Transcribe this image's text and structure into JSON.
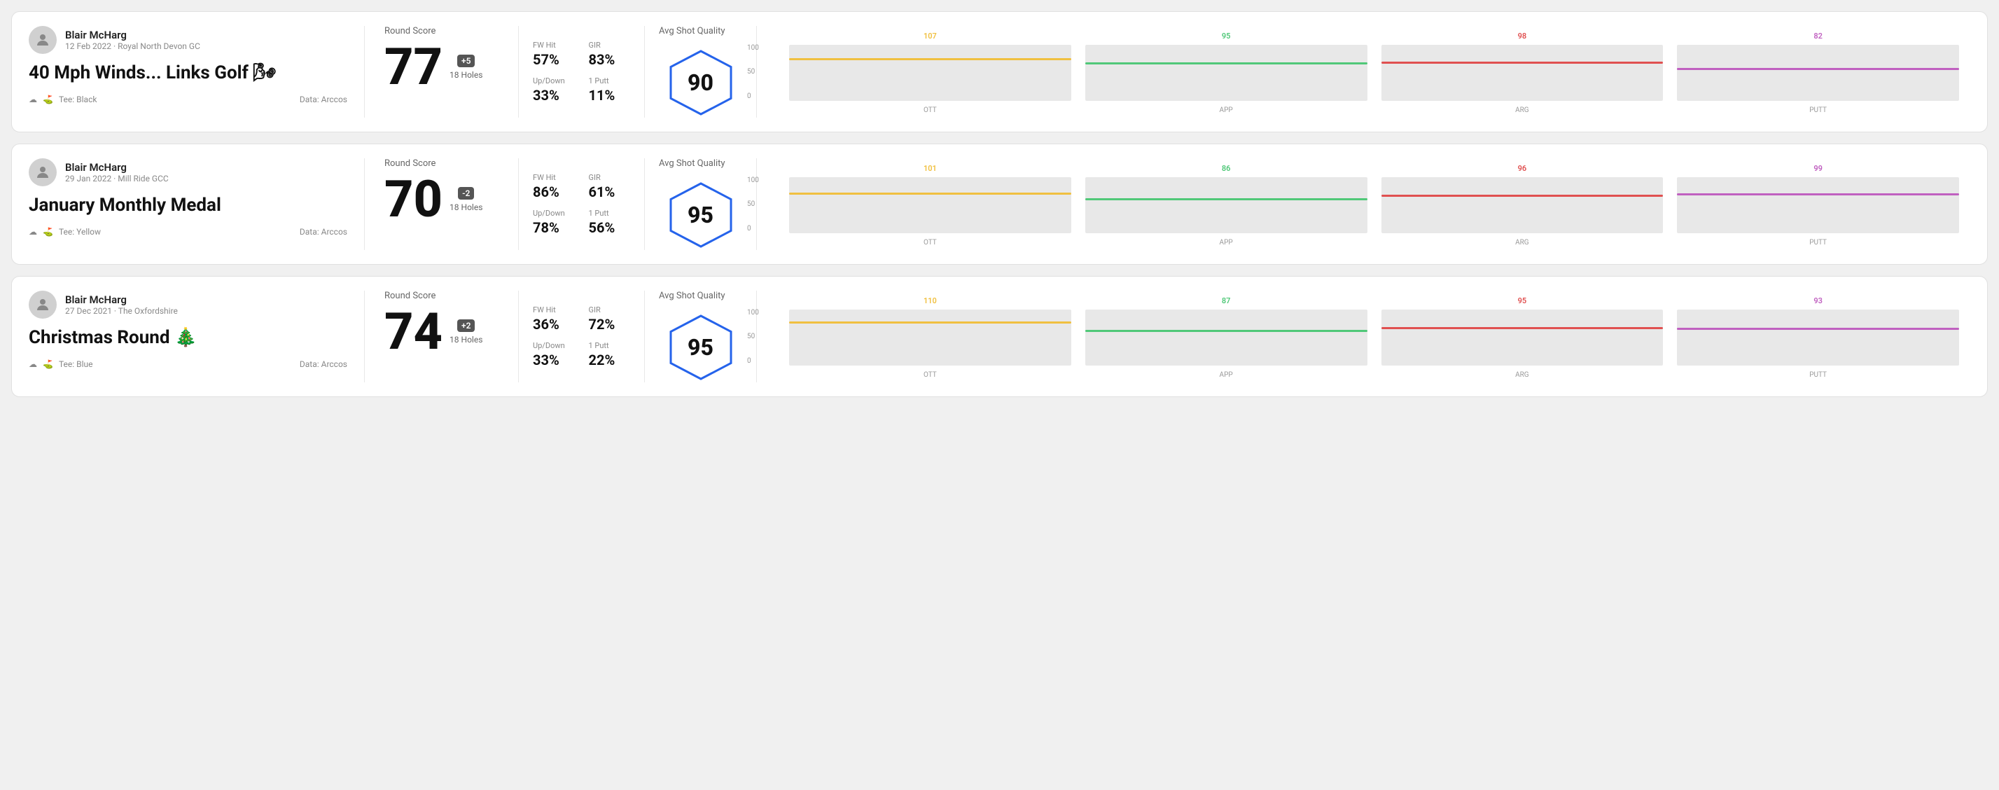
{
  "rounds": [
    {
      "id": "round1",
      "user": "Blair McHarg",
      "date": "12 Feb 2022",
      "course": "Royal North Devon GC",
      "title": "40 Mph Winds... Links Golf 🌬",
      "tee": "Black",
      "data_source": "Data: Arccos",
      "score": "77",
      "score_diff": "+5",
      "holes": "18 Holes",
      "fw_hit": "57%",
      "gir": "83%",
      "up_down": "33%",
      "one_putt": "11%",
      "avg_shot_quality": "90",
      "chart": {
        "ott": {
          "value": 107,
          "color": "#f0c040",
          "bar_height_pct": 72
        },
        "app": {
          "value": 95,
          "color": "#50c878",
          "bar_height_pct": 64
        },
        "arg": {
          "value": 98,
          "color": "#e05050",
          "bar_height_pct": 66
        },
        "putt": {
          "value": 82,
          "color": "#c060c0",
          "bar_height_pct": 55
        }
      }
    },
    {
      "id": "round2",
      "user": "Blair McHarg",
      "date": "29 Jan 2022",
      "course": "Mill Ride GCC",
      "title": "January Monthly Medal",
      "tee": "Yellow",
      "data_source": "Data: Arccos",
      "score": "70",
      "score_diff": "-2",
      "holes": "18 Holes",
      "fw_hit": "86%",
      "gir": "61%",
      "up_down": "78%",
      "one_putt": "56%",
      "avg_shot_quality": "95",
      "chart": {
        "ott": {
          "value": 101,
          "color": "#f0c040",
          "bar_height_pct": 68
        },
        "app": {
          "value": 86,
          "color": "#50c878",
          "bar_height_pct": 58
        },
        "arg": {
          "value": 96,
          "color": "#e05050",
          "bar_height_pct": 65
        },
        "putt": {
          "value": 99,
          "color": "#c060c0",
          "bar_height_pct": 67
        }
      }
    },
    {
      "id": "round3",
      "user": "Blair McHarg",
      "date": "27 Dec 2021",
      "course": "The Oxfordshire",
      "title": "Christmas Round 🎄",
      "tee": "Blue",
      "data_source": "Data: Arccos",
      "score": "74",
      "score_diff": "+2",
      "holes": "18 Holes",
      "fw_hit": "36%",
      "gir": "72%",
      "up_down": "33%",
      "one_putt": "22%",
      "avg_shot_quality": "95",
      "chart": {
        "ott": {
          "value": 110,
          "color": "#f0c040",
          "bar_height_pct": 74
        },
        "app": {
          "value": 87,
          "color": "#50c878",
          "bar_height_pct": 59
        },
        "arg": {
          "value": 95,
          "color": "#e05050",
          "bar_height_pct": 64
        },
        "putt": {
          "value": 93,
          "color": "#c060c0",
          "bar_height_pct": 63
        }
      }
    }
  ],
  "chart_y_labels": [
    "100",
    "50",
    "0"
  ],
  "chart_axes": [
    "OTT",
    "APP",
    "ARG",
    "PUTT"
  ]
}
